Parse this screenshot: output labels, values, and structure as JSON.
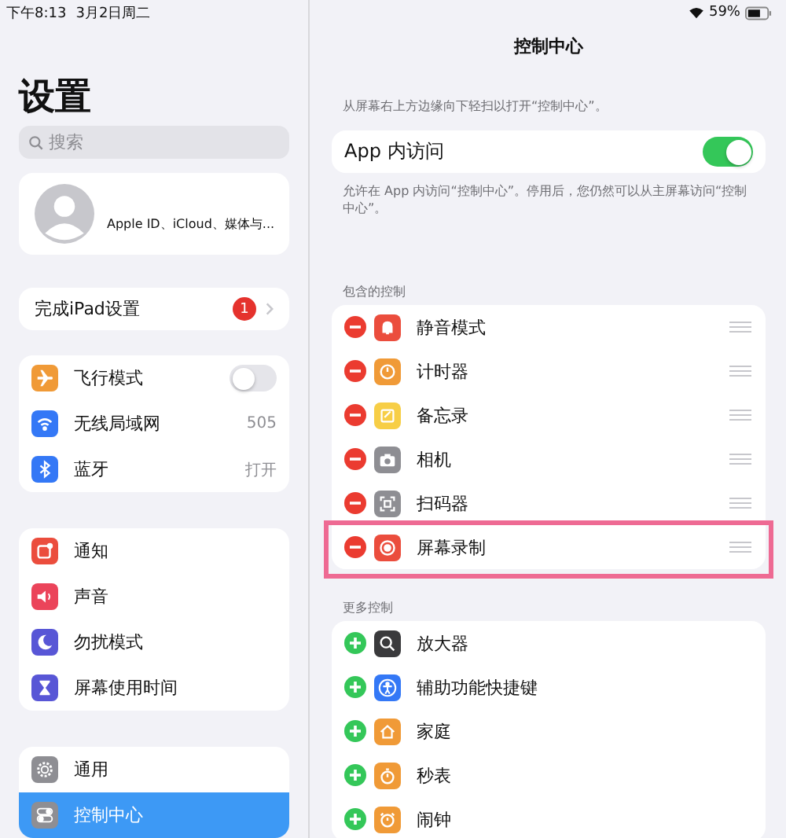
{
  "status_bar": {
    "time": "下午8:13",
    "date": "3月2日周二",
    "battery": "59%"
  },
  "sidebar": {
    "title": "设置",
    "search": {
      "placeholder": "搜索"
    },
    "account": {
      "subtitle": "Apple ID、iCloud、媒体与..."
    },
    "setup": {
      "label": "完成iPad设置",
      "badge": "1"
    },
    "groups": [
      [
        {
          "label": "飞行模式",
          "color": "#f09a37",
          "kind": "toggle",
          "on": false,
          "selected": false
        },
        {
          "label": "无线局域网",
          "color": "#3478f6",
          "kind": "value",
          "value": "505",
          "selected": false
        },
        {
          "label": "蓝牙",
          "color": "#3478f6",
          "kind": "value",
          "value": "打开",
          "selected": false
        }
      ],
      [
        {
          "label": "通知",
          "color": "#eb4d3d",
          "kind": "plain",
          "selected": false
        },
        {
          "label": "声音",
          "color": "#eb445a",
          "kind": "plain",
          "selected": false
        },
        {
          "label": "勿扰模式",
          "color": "#5856d6",
          "kind": "plain",
          "selected": false
        },
        {
          "label": "屏幕使用时间",
          "color": "#5856d6",
          "kind": "plain",
          "selected": false
        }
      ],
      [
        {
          "label": "通用",
          "color": "#8e8e93",
          "kind": "plain",
          "selected": false
        },
        {
          "label": "控制中心",
          "color": "#8e8e93",
          "kind": "plain",
          "selected": true
        }
      ]
    ]
  },
  "detail": {
    "title": "控制中心",
    "description": "从屏幕右上方边缘向下轻扫以打开“控制中心”。",
    "access": {
      "label": "App 内访问",
      "on": true
    },
    "footnote": "允许在 App 内访问“控制中心”。停用后，您仍然可以从主屏幕访问“控制中心”。",
    "included": {
      "header": "包含的控制",
      "items": [
        {
          "label": "静音模式",
          "color": "#eb4d3d",
          "highlighted": false
        },
        {
          "label": "计时器",
          "color": "#f09a37",
          "highlighted": false
        },
        {
          "label": "备忘录",
          "color": "#f7ce46",
          "highlighted": false
        },
        {
          "label": "相机",
          "color": "#8e8e93",
          "highlighted": false
        },
        {
          "label": "扫码器",
          "color": "#8e8e93",
          "highlighted": false
        },
        {
          "label": "屏幕录制",
          "color": "#eb4d3d",
          "highlighted": true
        }
      ]
    },
    "more": {
      "header": "更多控制",
      "items": [
        {
          "label": "放大器",
          "color": "#3a3a3c"
        },
        {
          "label": "辅助功能快捷键",
          "color": "#3478f6"
        },
        {
          "label": "家庭",
          "color": "#f09a37"
        },
        {
          "label": "秒表",
          "color": "#f09a37"
        },
        {
          "label": "闹钟",
          "color": "#f09a37"
        }
      ]
    }
  }
}
